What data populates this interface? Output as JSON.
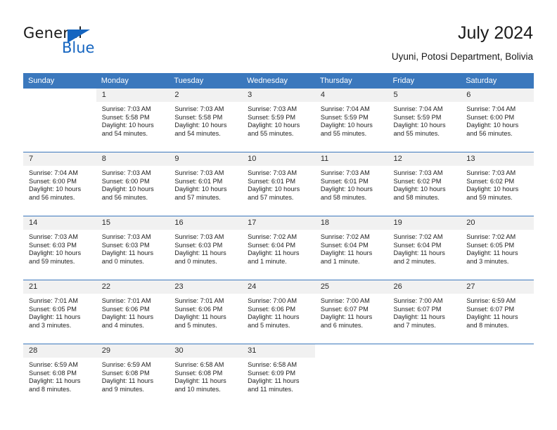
{
  "brand": {
    "name_part1": "General",
    "name_part2": "Blue",
    "triangle_color": "#1565c0"
  },
  "header": {
    "title": "July 2024",
    "subtitle": "Uyuni, Potosi Department, Bolivia"
  },
  "theme": {
    "header_blue": "#3b78bd",
    "daynum_band": "#f1f1f1",
    "text": "#232323"
  },
  "weekday_headers": [
    "Sunday",
    "Monday",
    "Tuesday",
    "Wednesday",
    "Thursday",
    "Friday",
    "Saturday"
  ],
  "weeks": [
    [
      {
        "day": "",
        "sunrise": "",
        "sunset": "",
        "daylight1": "",
        "daylight2": ""
      },
      {
        "day": "1",
        "sunrise": "Sunrise: 7:03 AM",
        "sunset": "Sunset: 5:58 PM",
        "daylight1": "Daylight: 10 hours",
        "daylight2": "and 54 minutes."
      },
      {
        "day": "2",
        "sunrise": "Sunrise: 7:03 AM",
        "sunset": "Sunset: 5:58 PM",
        "daylight1": "Daylight: 10 hours",
        "daylight2": "and 54 minutes."
      },
      {
        "day": "3",
        "sunrise": "Sunrise: 7:03 AM",
        "sunset": "Sunset: 5:59 PM",
        "daylight1": "Daylight: 10 hours",
        "daylight2": "and 55 minutes."
      },
      {
        "day": "4",
        "sunrise": "Sunrise: 7:04 AM",
        "sunset": "Sunset: 5:59 PM",
        "daylight1": "Daylight: 10 hours",
        "daylight2": "and 55 minutes."
      },
      {
        "day": "5",
        "sunrise": "Sunrise: 7:04 AM",
        "sunset": "Sunset: 5:59 PM",
        "daylight1": "Daylight: 10 hours",
        "daylight2": "and 55 minutes."
      },
      {
        "day": "6",
        "sunrise": "Sunrise: 7:04 AM",
        "sunset": "Sunset: 6:00 PM",
        "daylight1": "Daylight: 10 hours",
        "daylight2": "and 56 minutes."
      }
    ],
    [
      {
        "day": "7",
        "sunrise": "Sunrise: 7:04 AM",
        "sunset": "Sunset: 6:00 PM",
        "daylight1": "Daylight: 10 hours",
        "daylight2": "and 56 minutes."
      },
      {
        "day": "8",
        "sunrise": "Sunrise: 7:03 AM",
        "sunset": "Sunset: 6:00 PM",
        "daylight1": "Daylight: 10 hours",
        "daylight2": "and 56 minutes."
      },
      {
        "day": "9",
        "sunrise": "Sunrise: 7:03 AM",
        "sunset": "Sunset: 6:01 PM",
        "daylight1": "Daylight: 10 hours",
        "daylight2": "and 57 minutes."
      },
      {
        "day": "10",
        "sunrise": "Sunrise: 7:03 AM",
        "sunset": "Sunset: 6:01 PM",
        "daylight1": "Daylight: 10 hours",
        "daylight2": "and 57 minutes."
      },
      {
        "day": "11",
        "sunrise": "Sunrise: 7:03 AM",
        "sunset": "Sunset: 6:01 PM",
        "daylight1": "Daylight: 10 hours",
        "daylight2": "and 58 minutes."
      },
      {
        "day": "12",
        "sunrise": "Sunrise: 7:03 AM",
        "sunset": "Sunset: 6:02 PM",
        "daylight1": "Daylight: 10 hours",
        "daylight2": "and 58 minutes."
      },
      {
        "day": "13",
        "sunrise": "Sunrise: 7:03 AM",
        "sunset": "Sunset: 6:02 PM",
        "daylight1": "Daylight: 10 hours",
        "daylight2": "and 59 minutes."
      }
    ],
    [
      {
        "day": "14",
        "sunrise": "Sunrise: 7:03 AM",
        "sunset": "Sunset: 6:03 PM",
        "daylight1": "Daylight: 10 hours",
        "daylight2": "and 59 minutes."
      },
      {
        "day": "15",
        "sunrise": "Sunrise: 7:03 AM",
        "sunset": "Sunset: 6:03 PM",
        "daylight1": "Daylight: 11 hours",
        "daylight2": "and 0 minutes."
      },
      {
        "day": "16",
        "sunrise": "Sunrise: 7:03 AM",
        "sunset": "Sunset: 6:03 PM",
        "daylight1": "Daylight: 11 hours",
        "daylight2": "and 0 minutes."
      },
      {
        "day": "17",
        "sunrise": "Sunrise: 7:02 AM",
        "sunset": "Sunset: 6:04 PM",
        "daylight1": "Daylight: 11 hours",
        "daylight2": "and 1 minute."
      },
      {
        "day": "18",
        "sunrise": "Sunrise: 7:02 AM",
        "sunset": "Sunset: 6:04 PM",
        "daylight1": "Daylight: 11 hours",
        "daylight2": "and 1 minute."
      },
      {
        "day": "19",
        "sunrise": "Sunrise: 7:02 AM",
        "sunset": "Sunset: 6:04 PM",
        "daylight1": "Daylight: 11 hours",
        "daylight2": "and 2 minutes."
      },
      {
        "day": "20",
        "sunrise": "Sunrise: 7:02 AM",
        "sunset": "Sunset: 6:05 PM",
        "daylight1": "Daylight: 11 hours",
        "daylight2": "and 3 minutes."
      }
    ],
    [
      {
        "day": "21",
        "sunrise": "Sunrise: 7:01 AM",
        "sunset": "Sunset: 6:05 PM",
        "daylight1": "Daylight: 11 hours",
        "daylight2": "and 3 minutes."
      },
      {
        "day": "22",
        "sunrise": "Sunrise: 7:01 AM",
        "sunset": "Sunset: 6:06 PM",
        "daylight1": "Daylight: 11 hours",
        "daylight2": "and 4 minutes."
      },
      {
        "day": "23",
        "sunrise": "Sunrise: 7:01 AM",
        "sunset": "Sunset: 6:06 PM",
        "daylight1": "Daylight: 11 hours",
        "daylight2": "and 5 minutes."
      },
      {
        "day": "24",
        "sunrise": "Sunrise: 7:00 AM",
        "sunset": "Sunset: 6:06 PM",
        "daylight1": "Daylight: 11 hours",
        "daylight2": "and 5 minutes."
      },
      {
        "day": "25",
        "sunrise": "Sunrise: 7:00 AM",
        "sunset": "Sunset: 6:07 PM",
        "daylight1": "Daylight: 11 hours",
        "daylight2": "and 6 minutes."
      },
      {
        "day": "26",
        "sunrise": "Sunrise: 7:00 AM",
        "sunset": "Sunset: 6:07 PM",
        "daylight1": "Daylight: 11 hours",
        "daylight2": "and 7 minutes."
      },
      {
        "day": "27",
        "sunrise": "Sunrise: 6:59 AM",
        "sunset": "Sunset: 6:07 PM",
        "daylight1": "Daylight: 11 hours",
        "daylight2": "and 8 minutes."
      }
    ],
    [
      {
        "day": "28",
        "sunrise": "Sunrise: 6:59 AM",
        "sunset": "Sunset: 6:08 PM",
        "daylight1": "Daylight: 11 hours",
        "daylight2": "and 8 minutes."
      },
      {
        "day": "29",
        "sunrise": "Sunrise: 6:59 AM",
        "sunset": "Sunset: 6:08 PM",
        "daylight1": "Daylight: 11 hours",
        "daylight2": "and 9 minutes."
      },
      {
        "day": "30",
        "sunrise": "Sunrise: 6:58 AM",
        "sunset": "Sunset: 6:08 PM",
        "daylight1": "Daylight: 11 hours",
        "daylight2": "and 10 minutes."
      },
      {
        "day": "31",
        "sunrise": "Sunrise: 6:58 AM",
        "sunset": "Sunset: 6:09 PM",
        "daylight1": "Daylight: 11 hours",
        "daylight2": "and 11 minutes."
      },
      {
        "day": "",
        "sunrise": "",
        "sunset": "",
        "daylight1": "",
        "daylight2": ""
      },
      {
        "day": "",
        "sunrise": "",
        "sunset": "",
        "daylight1": "",
        "daylight2": ""
      },
      {
        "day": "",
        "sunrise": "",
        "sunset": "",
        "daylight1": "",
        "daylight2": ""
      }
    ]
  ]
}
